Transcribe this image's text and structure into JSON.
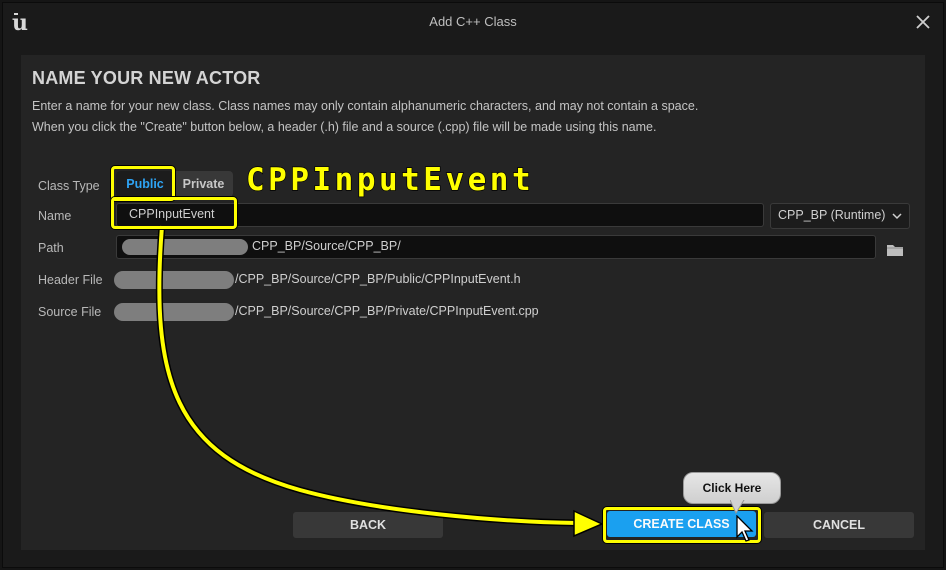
{
  "window": {
    "title": "Add C++ Class",
    "logo_icon": "unreal-engine-logo",
    "close_icon": "close-icon"
  },
  "panel": {
    "heading": "NAME YOUR NEW ACTOR",
    "description_line1": "Enter a name for your new class. Class names may only contain alphanumeric characters, and may not contain a space.",
    "description_line2": "When you click the \"Create\" button below, a header (.h) file and a source (.cpp) file will be made using this name."
  },
  "form": {
    "class_type_label": "Class Type",
    "class_type_options": [
      "Public",
      "Private"
    ],
    "class_type_selected": "Public",
    "name_label": "Name",
    "name_value": "CPPInputEvent",
    "module_value": "CPP_BP (Runtime)",
    "path_label": "Path",
    "path_value": "CPP_BP/Source/CPP_BP/",
    "header_label": "Header File",
    "header_value": "/CPP_BP/Source/CPP_BP/Public/CPPInputEvent.h",
    "source_label": "Source File",
    "source_value": "/CPP_BP/Source/CPP_BP/Private/CPPInputEvent.cpp"
  },
  "buttons": {
    "back": "BACK",
    "create": "CREATE CLASS",
    "cancel": "CANCEL"
  },
  "annotations": {
    "big_label": "CPPInputEvent",
    "callout": "Click Here",
    "highlight_color": "#ffff00"
  },
  "colors": {
    "accent": "#1aa0f0",
    "public_text": "#2ea4f5",
    "panel_bg": "#242424"
  }
}
